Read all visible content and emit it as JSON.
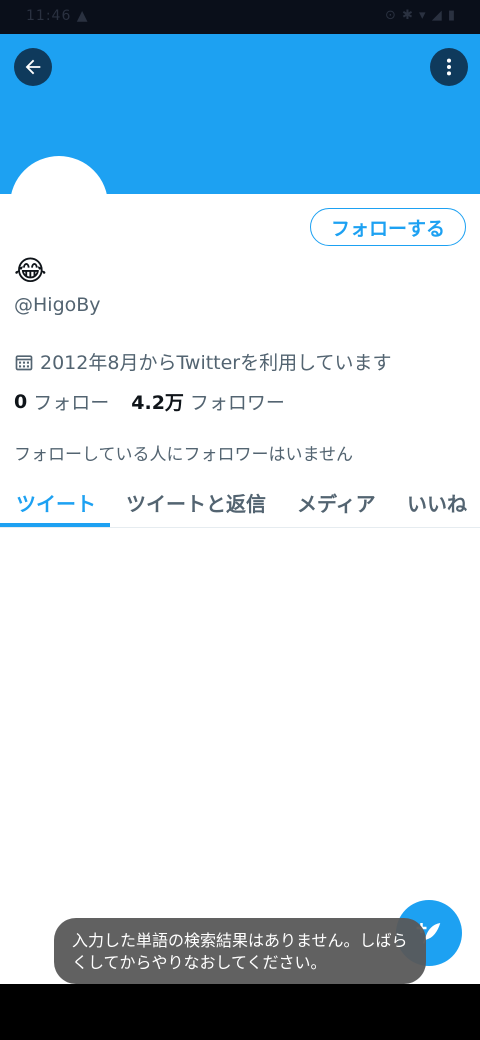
{
  "status_bar": {
    "left": "11:46 ▲",
    "right": "⊙ ✱ ▾ ◢ ▮"
  },
  "header": {
    "back_icon": "arrow-left-icon",
    "more_icon": "more-vertical-icon"
  },
  "profile": {
    "follow_label": "フォローする",
    "display_name": "😂",
    "handle": "@HigoBy",
    "joined": "2012年8月からTwitterを利用しています",
    "following_count": "0",
    "following_label": "フォロー",
    "followers_count": "4.2万",
    "followers_label": "フォロワー",
    "followed_by": "フォローしている人にフォロワーはいません"
  },
  "tabs": [
    {
      "label": "ツイート",
      "active": true
    },
    {
      "label": "ツイートと返信",
      "active": false
    },
    {
      "label": "メディア",
      "active": false
    },
    {
      "label": "いいね",
      "active": false
    }
  ],
  "toast": {
    "message": "入力した単語の検索結果はありません。しばらくしてからやりなおしてください。"
  },
  "colors": {
    "accent": "#1da1f2",
    "text_secondary": "#536471",
    "toast_bg": "#585858"
  }
}
